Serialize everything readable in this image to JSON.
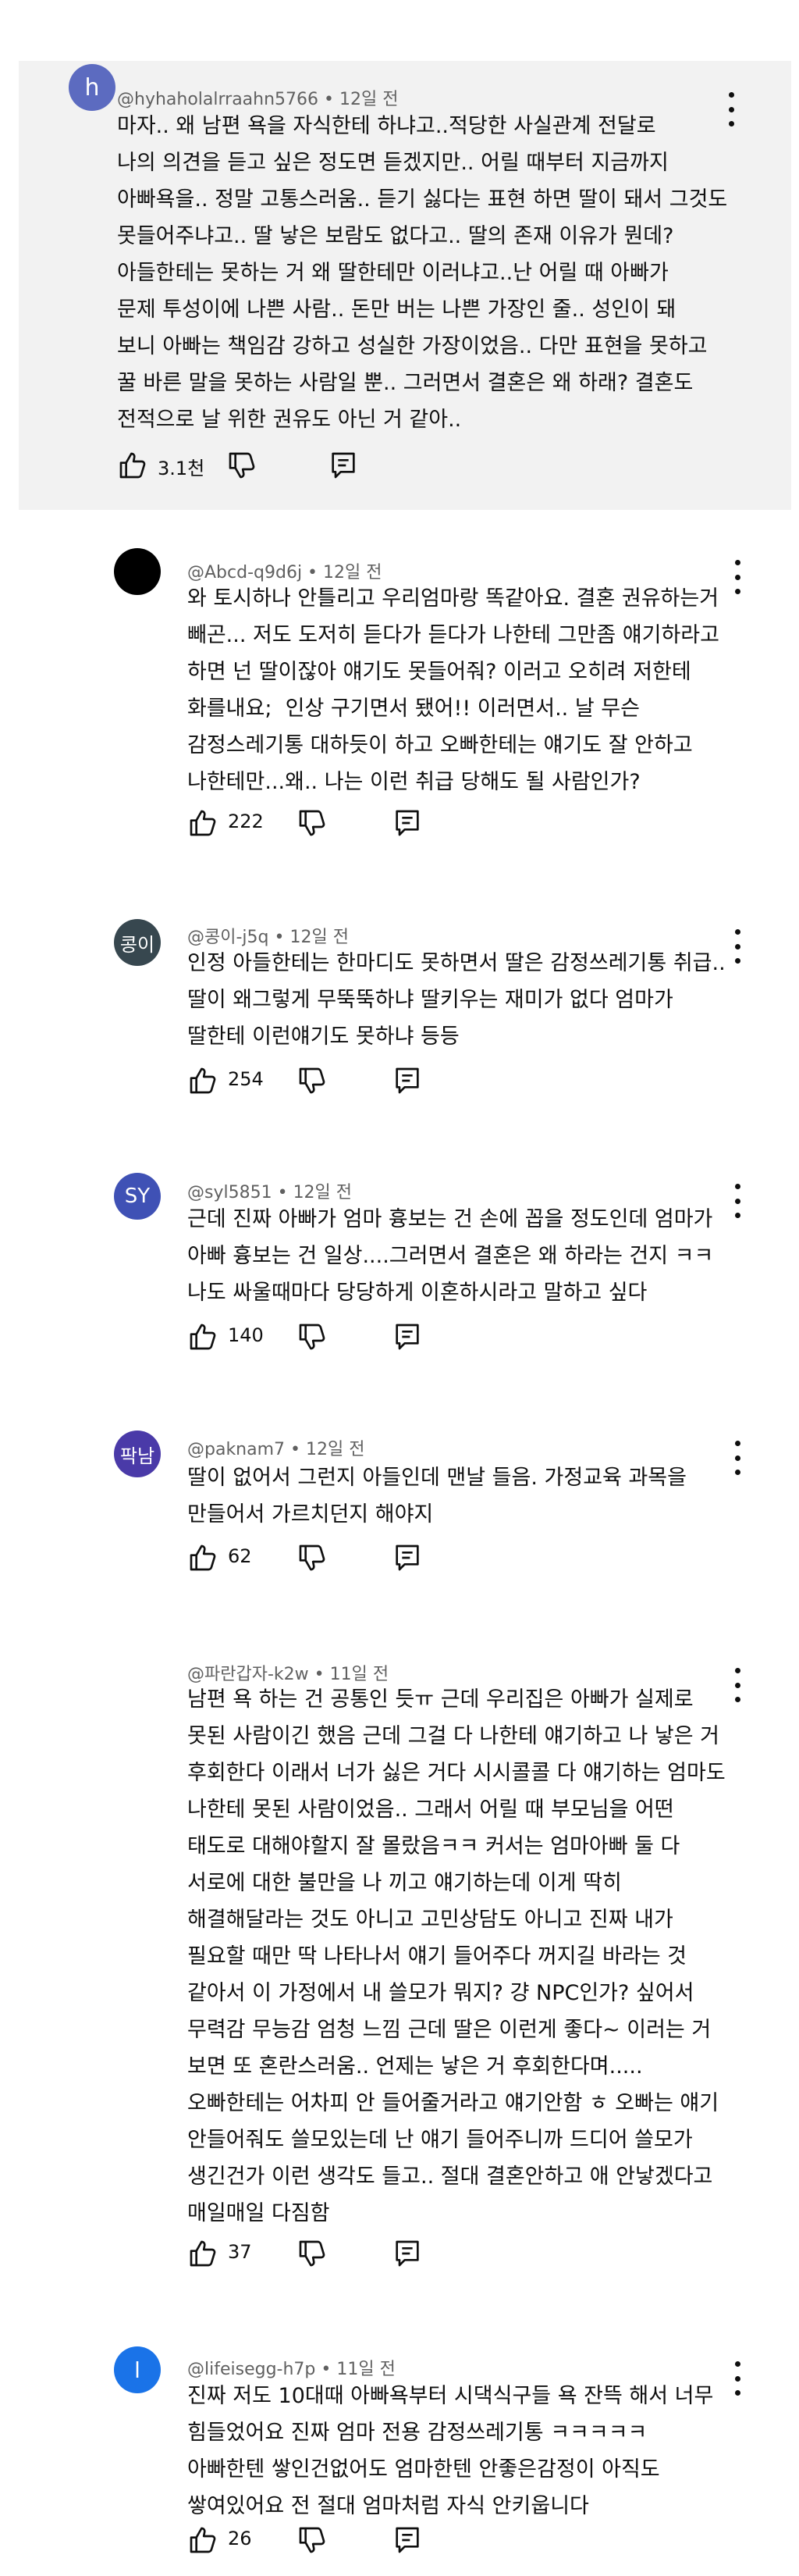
{
  "comments": [
    {
      "author": "@hyhaholalrraahn5766",
      "time": "12일 전",
      "avatar_text": "h",
      "avatar_color": "#5c6bc0",
      "likes": "3.1천",
      "lines": [
        "마자.. 왜 남편 욕을 자식한테 하냐고..적당한 사실관계 전달로",
        "나의 의견을 듣고 싶은 정도면 듣겠지만.. 어릴 때부터 지금까지",
        "아빠욕을.. 정말 고통스러움.. 듣기 싫다는 표현 하면 딸이 돼서 그것도",
        "못들어주냐고.. 딸 낳은 보람도 없다고.. 딸의 존재 이유가 뭔데?",
        "아들한테는 못하는 거 왜 딸한테만 이러냐고..난 어릴 때 아빠가",
        "문제 투성이에 나쁜 사람.. 돈만 버는 나쁜 가장인 줄.. 성인이 돼",
        "보니 아빠는 책임감 강하고 성실한 가장이었음.. 다만 표현을 못하고",
        "꿀 바른 말을 못하는 사람일 뿐.. 그러면서 결혼은 왜 하래? 결혼도",
        "전적으로 날 위한 권유도 아닌 거 같아.."
      ]
    },
    {
      "author": "@Abcd-q9d6j",
      "time": "12일 전",
      "avatar_text": "",
      "avatar_color": "#000000",
      "likes": "222",
      "lines": [
        "와 토시하나 안틀리고 우리엄마랑 똑같아요. 결혼 권유하는거",
        "빼곤... 저도 도저히 듣다가 듣다가 나한테 그만좀 얘기하라고",
        "하면 넌 딸이잖아 얘기도 못들어줘? 이러고 오히려 저한테",
        "화를내요;  인상 구기면서 됐어!! 이러면서.. 날 무슨",
        "감정스레기통 대하듯이 하고 오빠한테는 얘기도 잘 안하고",
        "나한테만...왜.. 나는 이런 취급 당해도 될 사람인가?"
      ]
    },
    {
      "author": "@콩이-j5q",
      "time": "12일 전",
      "avatar_text": "콩이",
      "avatar_color": "#37474f",
      "likes": "254",
      "lines": [
        "인정 아들한테는 한마디도 못하면서 딸은 감정쓰레기통 취급..",
        "딸이 왜그렇게 무뚝뚝하냐 딸키우는 재미가 없다 엄마가",
        "딸한테 이런얘기도 못하냐 등등"
      ]
    },
    {
      "author": "@syl5851",
      "time": "12일 전",
      "avatar_text": "SY",
      "avatar_color": "#3f51b5",
      "likes": "140",
      "lines": [
        "근데 진짜 아빠가 엄마 흉보는 건 손에 꼽을 정도인데 엄마가",
        "아빠 흉보는 건 일상....그러면서 결혼은 왜 하라는 건지 ㅋㅋ",
        "나도 싸울때마다 당당하게 이혼하시라고 말하고 싶다"
      ]
    },
    {
      "author": "@paknam7",
      "time": "12일 전",
      "avatar_text": "팍남",
      "avatar_color": "#4a3aa8",
      "likes": "62",
      "lines": [
        "딸이 없어서 그런지 아들인데 맨날 들음. 가정교육 과목을",
        "만들어서 가르치던지 해야지"
      ]
    },
    {
      "author": "@파란갑자-k2w",
      "time": "11일 전",
      "avatar_text": "",
      "avatar_color": "#ffffff",
      "likes": "37",
      "lines": [
        "남편 욕 하는 건 공통인 듯ㅠ 근데 우리집은 아빠가 실제로",
        "못된 사람이긴 했음 근데 그걸 다 나한테 얘기하고 나 낳은 거",
        "후회한다 이래서 너가 싫은 거다 시시콜콜 다 얘기하는 엄마도",
        "나한테 못된 사람이었음.. 그래서 어릴 때 부모님을 어떤",
        "태도로 대해야할지 잘 몰랐음ㅋㅋ 커서는 엄마아빠 둘 다",
        "서로에 대한 불만을 나 끼고 얘기하는데 이게 딱히",
        "해결해달라는 것도 아니고 고민상담도 아니고 진짜 내가",
        "필요할 때만 딱 나타나서 얘기 들어주다 꺼지길 바라는 것",
        "같아서 이 가정에서 내 쓸모가 뭐지? 걍 NPC인가? 싶어서",
        "무력감 무능감 엄청 느낌 근데 딸은 이런게 좋다~ 이러는 거",
        "보면 또 혼란스러움.. 언제는 낳은 거 후회한다며.....",
        "오빠한테는 어차피 안 들어줄거라고 얘기안함 ㅎ 오빠는 얘기",
        "안들어줘도 쓸모있는데 난 얘기 들어주니까 드디어 쓸모가",
        "생긴건가 이런 생각도 들고.. 절대 결혼안하고 애 안낳겠다고",
        "매일매일 다짐함"
      ]
    },
    {
      "author": "@lifeisegg-h7p",
      "time": "11일 전",
      "avatar_text": "l",
      "avatar_color": "#1a73e8",
      "likes": "26",
      "lines": [
        "진짜 저도 10대때 아빠욕부터 시댁식구들 욕 잔뜩 해서 너무",
        "힘들었어요 진짜 엄마 전용 감정쓰레기통 ㅋㅋㅋㅋㅋ",
        "아빠한텐 쌓인건없어도 엄마한텐 안좋은감정이 아직도",
        "쌓여있어요 전 절대 엄마처럼 자식 안키웁니다"
      ]
    }
  ]
}
